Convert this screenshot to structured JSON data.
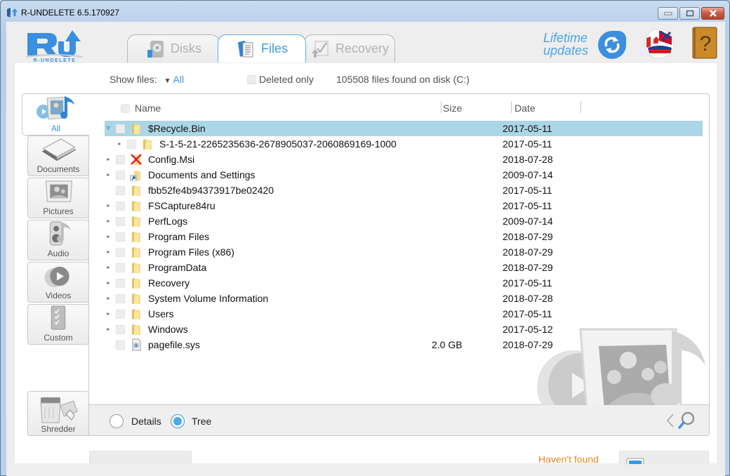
{
  "window": {
    "title": "R-UNDELETE 6.5.170927",
    "controls": [
      "minimize",
      "maximize",
      "close"
    ]
  },
  "header": {
    "logo_text": "R-UNDELETE",
    "tabs": [
      {
        "label": "Disks",
        "icon": "disk-icon",
        "active": false
      },
      {
        "label": "Files",
        "icon": "files-icon",
        "active": true
      },
      {
        "label": "Recovery",
        "icon": "recovery-icon",
        "active": false
      }
    ],
    "lifetime_line1": "Lifetime",
    "lifetime_line2": "updates",
    "update_icon": "refresh-icon",
    "language_icon": "language-flags-icon",
    "help_icon": "help-book-icon",
    "colors": {
      "accent": "#3d94dc",
      "selected_row": "#abd6e5",
      "orange": "#e08a2c"
    }
  },
  "filter": {
    "show_files_label": "Show files:",
    "show_files_value": "All",
    "deleted_only_label": "Deleted only",
    "deleted_only_checked": false,
    "files_found": "105508 files found on disk (C:)"
  },
  "sidebar": {
    "categories": [
      {
        "label": "All",
        "active": true
      },
      {
        "label": "Documents",
        "active": false
      },
      {
        "label": "Pictures",
        "active": false
      },
      {
        "label": "Audio",
        "active": false
      },
      {
        "label": "Videos",
        "active": false
      },
      {
        "label": "Custom",
        "active": false
      }
    ],
    "shredder_label": "Shredder"
  },
  "table": {
    "columns": {
      "name": "Name",
      "size": "Size",
      "date": "Date"
    },
    "rows": [
      {
        "name": "$Recycle.Bin",
        "size": "",
        "date": "2017-05-11",
        "level": 0,
        "expander": "open",
        "icon": "folder",
        "selected": true
      },
      {
        "name": "S-1-5-21-2265235636-2678905037-2060869169-1000",
        "size": "",
        "date": "2017-05-11",
        "level": 1,
        "expander": "closed",
        "icon": "folder",
        "selected": false
      },
      {
        "name": "Config.Msi",
        "size": "",
        "date": "2018-07-28",
        "level": 0,
        "expander": "closed",
        "icon": "folder-deleted",
        "selected": false
      },
      {
        "name": "Documents and Settings",
        "size": "",
        "date": "2009-07-14",
        "level": 0,
        "expander": "closed",
        "icon": "folder-shortcut",
        "selected": false
      },
      {
        "name": "fbb52fe4b94373917be02420",
        "size": "",
        "date": "2017-05-11",
        "level": 0,
        "expander": "none",
        "icon": "folder",
        "selected": false
      },
      {
        "name": "FSCapture84ru",
        "size": "",
        "date": "2017-05-11",
        "level": 0,
        "expander": "closed",
        "icon": "folder",
        "selected": false
      },
      {
        "name": "PerfLogs",
        "size": "",
        "date": "2009-07-14",
        "level": 0,
        "expander": "closed",
        "icon": "folder",
        "selected": false
      },
      {
        "name": "Program Files",
        "size": "",
        "date": "2018-07-29",
        "level": 0,
        "expander": "closed",
        "icon": "folder",
        "selected": false
      },
      {
        "name": "Program Files (x86)",
        "size": "",
        "date": "2018-07-29",
        "level": 0,
        "expander": "closed",
        "icon": "folder",
        "selected": false
      },
      {
        "name": "ProgramData",
        "size": "",
        "date": "2018-07-29",
        "level": 0,
        "expander": "closed",
        "icon": "folder",
        "selected": false
      },
      {
        "name": "Recovery",
        "size": "",
        "date": "2017-05-11",
        "level": 0,
        "expander": "closed",
        "icon": "folder",
        "selected": false
      },
      {
        "name": "System Volume Information",
        "size": "",
        "date": "2018-07-28",
        "level": 0,
        "expander": "closed",
        "icon": "folder",
        "selected": false
      },
      {
        "name": "Users",
        "size": "",
        "date": "2017-05-11",
        "level": 0,
        "expander": "closed",
        "icon": "folder",
        "selected": false
      },
      {
        "name": "Windows",
        "size": "",
        "date": "2017-05-12",
        "level": 0,
        "expander": "closed",
        "icon": "folder",
        "selected": false
      },
      {
        "name": "pagefile.sys",
        "size": "2.0 GB",
        "date": "2018-07-29",
        "level": 0,
        "expander": "none",
        "icon": "system-file",
        "selected": false
      }
    ]
  },
  "view_mode": {
    "details_label": "Details",
    "tree_label": "Tree",
    "selected": "Tree"
  },
  "footer": {
    "havent_found": "Haven't found"
  }
}
